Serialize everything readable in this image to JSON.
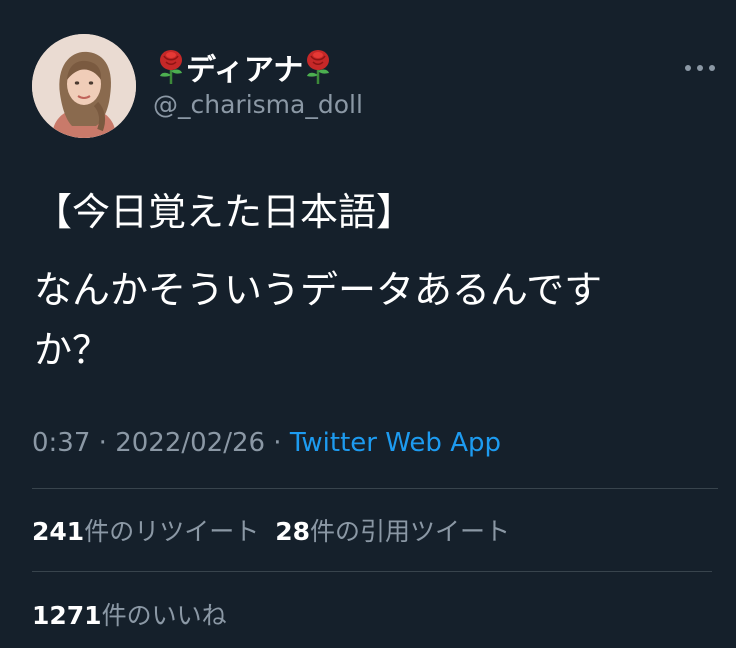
{
  "tweet": {
    "display_name": "ディアナ",
    "display_name_emoji": "rose-icon",
    "handle": "@_charisma_doll",
    "text_line1": "【今日覚えた日本語】",
    "text_line2": "なんかそういうデータあるんです",
    "text_line3": "か？",
    "time": "0:37",
    "date": "2022/02/26",
    "separator": " · ",
    "source": "Twitter Web App"
  },
  "stats": {
    "retweets_count": "241",
    "retweets_label": "件のリツイート",
    "quotes_count": "28",
    "quotes_label": "件の引用ツイート",
    "likes_count": "1271",
    "likes_label": "件のいいね"
  },
  "colors": {
    "background": "#15202b",
    "text_primary": "#ffffff",
    "text_secondary": "#8b98a5",
    "link": "#1d9bf0",
    "divider": "#38444d"
  }
}
